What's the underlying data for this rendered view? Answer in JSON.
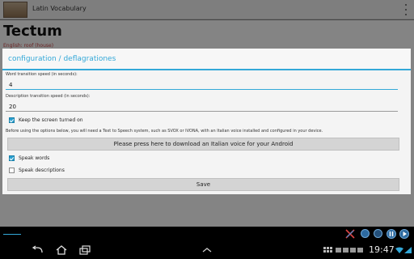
{
  "app": {
    "title": "Latin Vocabulary",
    "word": "Tectum",
    "word_translation": "English: roof (house)"
  },
  "dialog": {
    "title": "configuration / deflagrationes",
    "word_speed_label": "Word transition speed (in seconds):",
    "word_speed_value": "4",
    "desc_speed_label": "Description transition speed (in seconds):",
    "desc_speed_value": "20",
    "keep_screen_on_label": "Keep the screen turned on",
    "keep_screen_on_checked": true,
    "tts_note": "Before using the options below, you will need a Text to Speech system, such as SVOX or IVONA, with an Italian voice installed and configured in your device.",
    "download_voice_label": "Please press here to download an Italian voice for your Android",
    "speak_words_label": "Speak words",
    "speak_words_checked": true,
    "speak_descriptions_label": "Speak descriptions",
    "speak_descriptions_checked": false,
    "save_label": "Save"
  },
  "system_bar": {
    "time": "19:47",
    "icons": [
      "back-icon",
      "home-icon",
      "recent-apps-icon",
      "screenshot-icon",
      "up-chevron-icon",
      "grid-icon",
      "tools-icon",
      "media-icon",
      "pause-icon",
      "play-icon",
      "wifi-icon",
      "signal-icon"
    ]
  },
  "colors": {
    "accent": "#33a8d8",
    "dialog_bg": "#f4f4f4",
    "button_bg": "#d4d4d4"
  }
}
